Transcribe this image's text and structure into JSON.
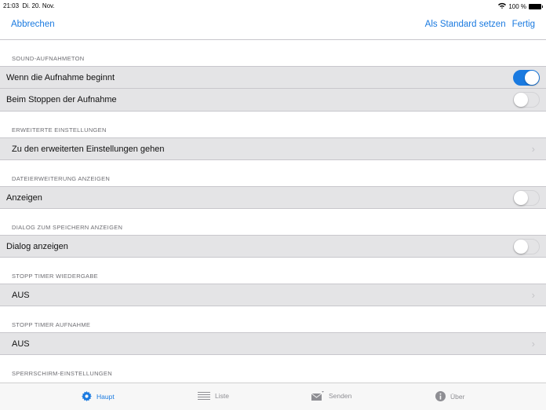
{
  "status": {
    "time": "21:03",
    "date": "Di. 20. Nov.",
    "battery": "100 %"
  },
  "nav": {
    "cancel": "Abbrechen",
    "set_default": "Als Standard setzen",
    "done": "Fertig"
  },
  "sections": {
    "sound": {
      "header": "SOUND-AUFNAHMETON",
      "row1": "Wenn die Aufnahme beginnt",
      "row1_on": true,
      "row2": "Beim Stoppen der Aufnahme",
      "row2_on": false
    },
    "advanced": {
      "header": "ERWEITERTE EINSTELLUNGEN",
      "row": "Zu den erweiterten Einstellungen gehen"
    },
    "extension": {
      "header": "DATEIERWEITERUNG ANZEIGEN",
      "row": "Anzeigen",
      "on": false
    },
    "save_dialog": {
      "header": "DIALOG ZUM SPEICHERN ANZEIGEN",
      "row": "Dialog anzeigen",
      "on": false
    },
    "timer_playback": {
      "header": "STOPP TIMER WIEDERGABE",
      "value": "AUS"
    },
    "timer_record": {
      "header": "STOPP TIMER AUFNAHME",
      "value": "AUS"
    },
    "lockscreen": {
      "header": "SPERRSCHIRM-EINSTELLUNGEN"
    }
  },
  "tabs": [
    {
      "label": "Haupt",
      "icon": "gear-icon",
      "active": true
    },
    {
      "label": "Liste",
      "icon": "list-icon",
      "active": false
    },
    {
      "label": "Senden",
      "icon": "send-mail-icon",
      "active": false
    },
    {
      "label": "Über",
      "icon": "info-icon",
      "active": false
    }
  ],
  "colors": {
    "accent": "#1a7ae0",
    "row_bg": "#e4e4e6",
    "inactive": "#8e8e93"
  }
}
